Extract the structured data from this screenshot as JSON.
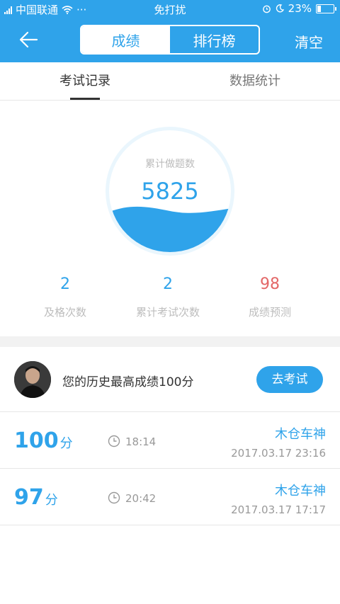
{
  "status_bar": {
    "carrier": "中国联通",
    "dots": "···",
    "mode": "免打扰",
    "battery": "23%",
    "battery_level": 0.23
  },
  "nav": {
    "tabs": [
      {
        "label": "成绩",
        "active": true
      },
      {
        "label": "排行榜",
        "active": false
      }
    ],
    "clear_label": "清空"
  },
  "subtabs": [
    {
      "label": "考试记录",
      "active": true
    },
    {
      "label": "数据统计",
      "active": false
    }
  ],
  "summary": {
    "total_label": "累计做题数",
    "total_value": "5825",
    "metrics": [
      {
        "value": "2",
        "label": "及格次数"
      },
      {
        "value": "2",
        "label": "累计考试次数"
      },
      {
        "value": "98",
        "label": "成绩预测"
      }
    ]
  },
  "best": {
    "text": "您的历史最高成绩100分",
    "button_label": "去考试"
  },
  "records": [
    {
      "score": "100",
      "unit": "分",
      "duration": "18:14",
      "user": "木仓车神",
      "date": "2017.03.17  23:16"
    },
    {
      "score": "97",
      "unit": "分",
      "duration": "20:42",
      "user": "木仓车神",
      "date": "2017.03.17  17:17"
    }
  ],
  "colors": {
    "primary": "#2fa3ea",
    "prediction": "#e36767"
  }
}
